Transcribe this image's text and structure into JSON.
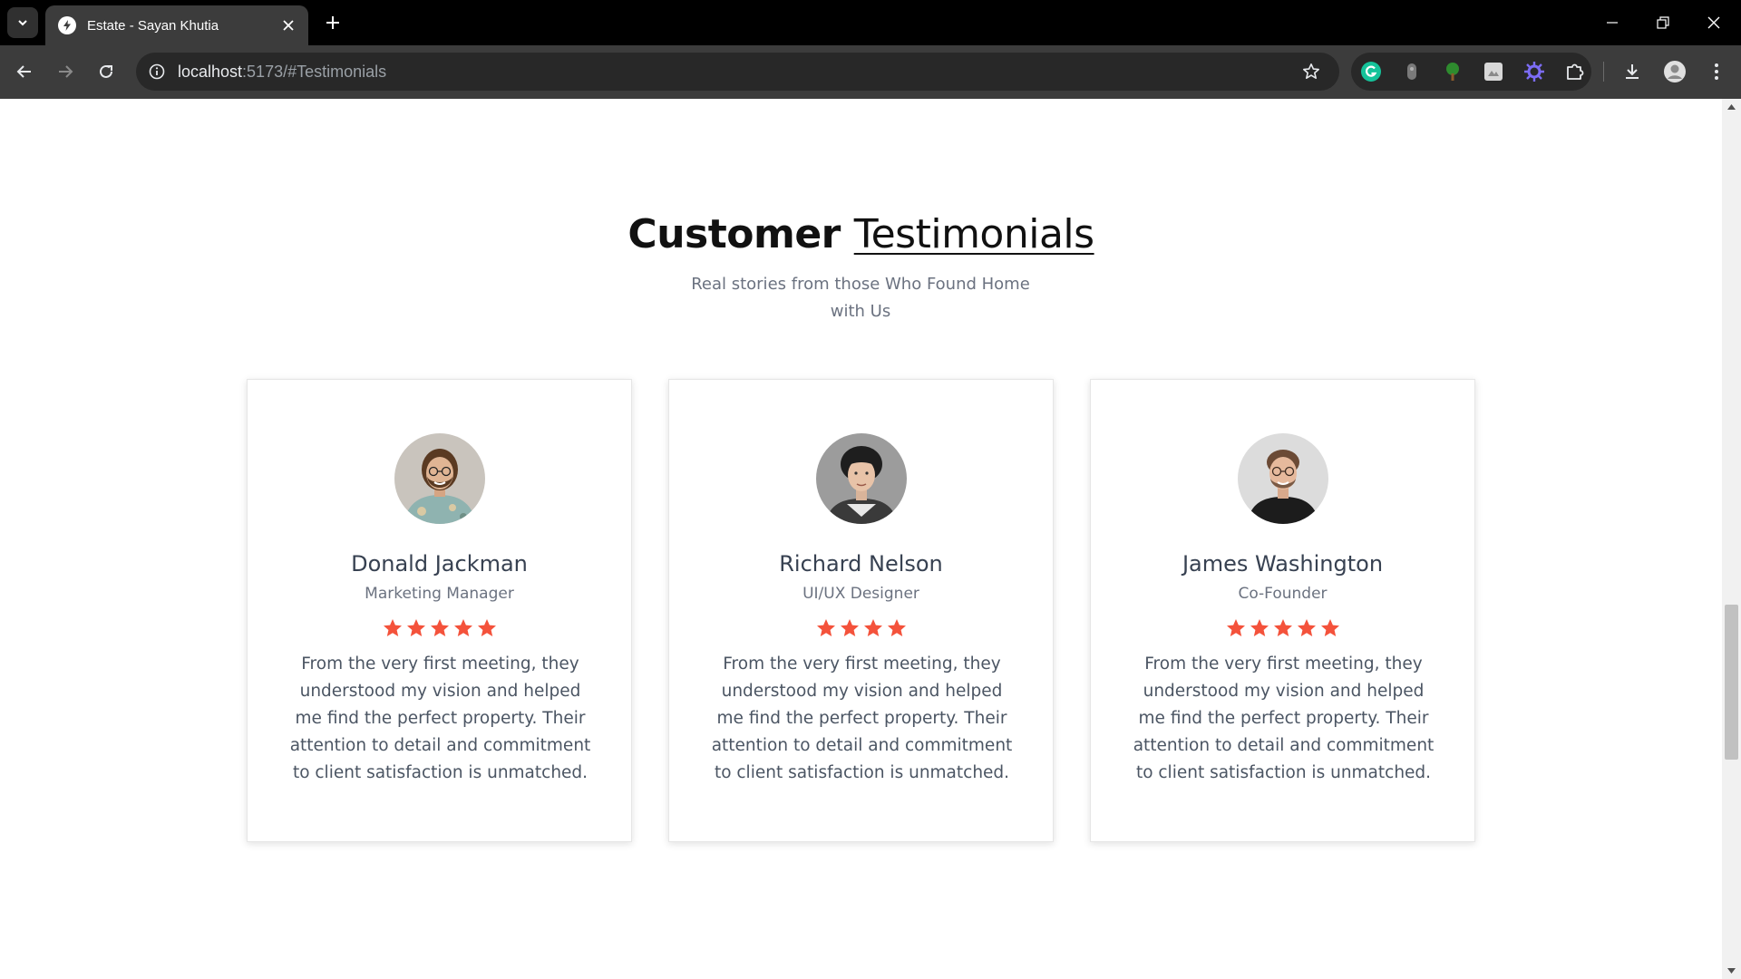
{
  "browser": {
    "tab_title": "Estate - Sayan Khutia",
    "url_host": "localhost",
    "url_rest": ":5173/#Testimonials"
  },
  "section": {
    "title_bold": "Customer",
    "title_light": "Testimonials",
    "subtitle": "Real stories from those Who Found Home with Us"
  },
  "testimonials": [
    {
      "name": "Donald Jackman",
      "role": "Marketing Manager",
      "rating": 5,
      "text": "From the very first meeting, they understood my vision and helped me find the perfect property. Their attention to detail and commitment to client satisfaction is unmatched."
    },
    {
      "name": "Richard Nelson",
      "role": "UI/UX Designer",
      "rating": 4,
      "text": "From the very first meeting, they understood my vision and helped me find the perfect property. Their attention to detail and commitment to client satisfaction is unmatched."
    },
    {
      "name": "James Washington",
      "role": "Co-Founder",
      "rating": 5,
      "text": "From the very first meeting, they understood my vision and helped me find the perfect property. Their attention to detail and commitment to client satisfaction is unmatched."
    }
  ],
  "colors": {
    "star": "#f4523b",
    "heading": "#111111",
    "muted": "#6b7280"
  },
  "icons": {
    "rating": "star-icon"
  }
}
